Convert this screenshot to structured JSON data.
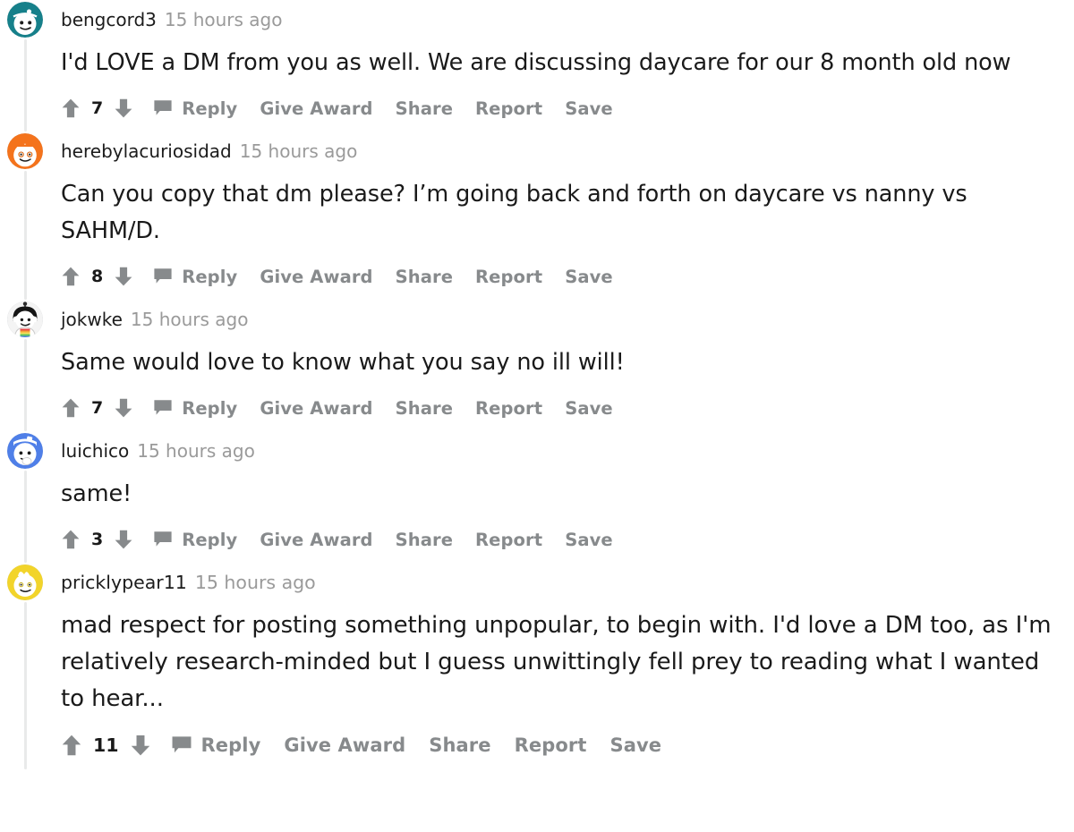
{
  "page": {
    "title": "Reddit comment thread",
    "colors": {
      "text": "#1a1a1a",
      "muted": "#878a8c",
      "timestamp": "#9a9a9a",
      "thread_line": "#e9eaea",
      "background": "#ffffff"
    }
  },
  "action_labels": {
    "reply": "Reply",
    "give_award": "Give Award",
    "share": "Share",
    "report": "Report",
    "save": "Save"
  },
  "icons": {
    "upvote": "upvote-arrow-icon",
    "downvote": "downvote-arrow-icon",
    "comment_bubble": "comment-bubble-icon",
    "avatar": "snoo-avatar-icon"
  },
  "comments": [
    {
      "username": "bengcord3",
      "timestamp": "15 hours ago",
      "body": "I'd LOVE a DM from you as well. We are discussing daycare for our 8 month old now",
      "score": "7",
      "avatar_color": "#16808a",
      "avatar_variant": "teal-bandana"
    },
    {
      "username": "herebylacuriosidad",
      "timestamp": "15 hours ago",
      "body": "Can you copy that dm please? I’m going back and forth on daycare vs nanny vs SAHM/D.",
      "score": "8",
      "avatar_color": "#f4731c",
      "avatar_variant": "orange-hair"
    },
    {
      "username": "jokwke",
      "timestamp": "15 hours ago",
      "body": "Same would love to know what you say no ill will!",
      "score": "7",
      "avatar_color": "#f2f2f2",
      "avatar_variant": "black-hair-rainbow-shirt"
    },
    {
      "username": "luichico",
      "timestamp": "15 hours ago",
      "body": "same!",
      "score": "3",
      "avatar_color": "#4f7fe8",
      "avatar_variant": "blue-thinking"
    },
    {
      "username": "pricklypear11",
      "timestamp": "15 hours ago",
      "body": "mad respect for posting something unpopular, to begin with. I'd love a DM too, as I'm relatively research-minded but I guess unwittingly fell prey to reading what I wanted to hear...",
      "score": "11",
      "avatar_color": "#f2d42a",
      "avatar_variant": "yellow-tuft"
    }
  ]
}
